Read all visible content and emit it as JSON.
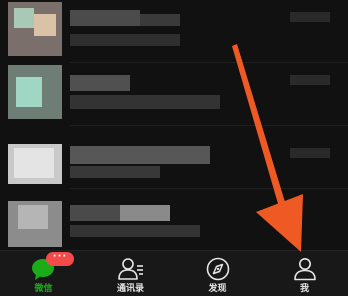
{
  "tabbar": {
    "tabs": [
      {
        "label": "微信",
        "icon": "chat-bubble-icon",
        "active": true,
        "badge": "···"
      },
      {
        "label": "通讯录",
        "icon": "contacts-icon",
        "active": false
      },
      {
        "label": "发现",
        "icon": "compass-icon",
        "active": false
      },
      {
        "label": "我",
        "icon": "person-icon",
        "active": false
      }
    ]
  },
  "colors": {
    "active": "#1aad19",
    "inactive": "#e6e6e6",
    "badge": "#f34a4a",
    "arrow": "#ef5a24",
    "background": "#111111",
    "tabbar": "#181818"
  }
}
